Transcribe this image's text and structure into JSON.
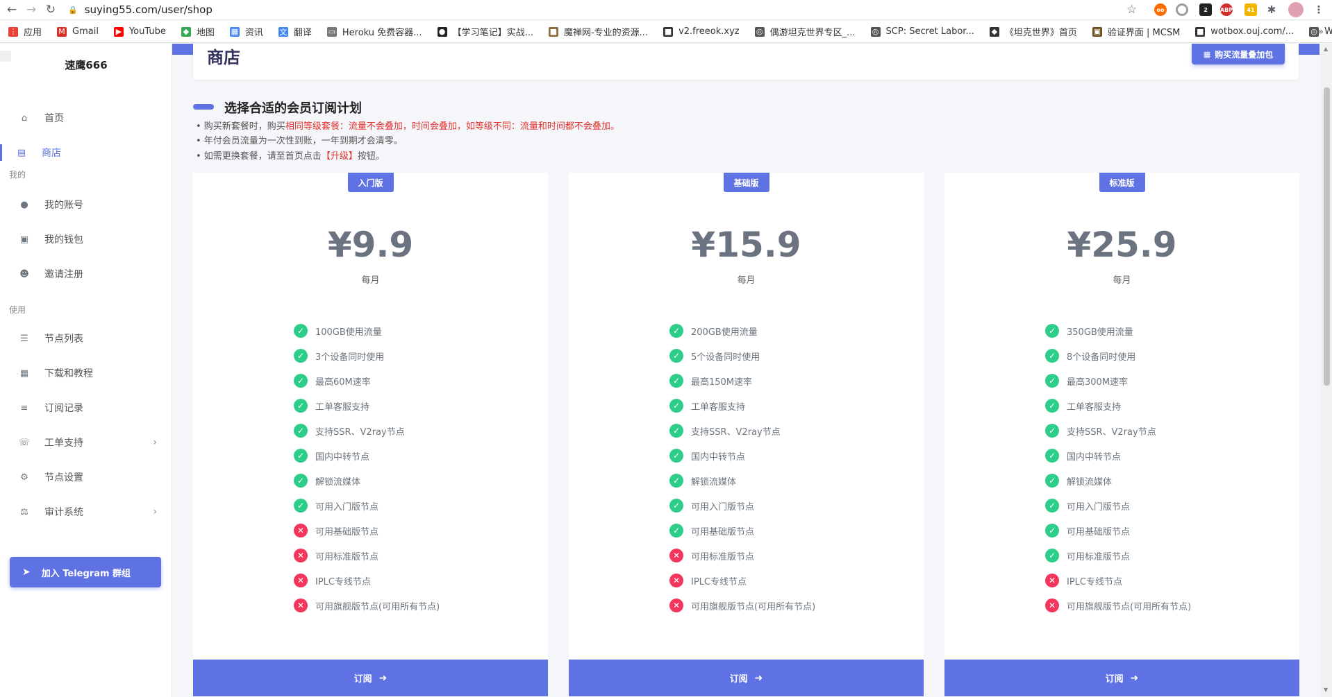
{
  "browser": {
    "url": "suying55.com/user/shop",
    "bookmarks": [
      {
        "label": "应用",
        "icon": "apps-icon",
        "color": "#e94235"
      },
      {
        "label": "Gmail",
        "icon": "gmail-icon",
        "color": "#d93025"
      },
      {
        "label": "YouTube",
        "icon": "youtube-icon",
        "color": "#ff0000"
      },
      {
        "label": "地图",
        "icon": "maps-icon",
        "color": "#34a853"
      },
      {
        "label": "资讯",
        "icon": "news-icon",
        "color": "#4285f4"
      },
      {
        "label": "翻译",
        "icon": "translate-icon",
        "color": "#4285f4"
      },
      {
        "label": "Heroku 免费容器...",
        "icon": "page-icon",
        "color": "#777777"
      },
      {
        "label": "【学习笔记】实战...",
        "icon": "github-icon",
        "color": "#222222"
      },
      {
        "label": "魔禅网-专业的资源...",
        "icon": "site-icon",
        "color": "#8a6d3b"
      },
      {
        "label": "v2.freeok.xyz",
        "icon": "site-icon",
        "color": "#333333"
      },
      {
        "label": "偶游坦克世界专区_...",
        "icon": "globe-icon",
        "color": "#555555"
      },
      {
        "label": "SCP: Secret Labor...",
        "icon": "globe-icon",
        "color": "#555555"
      },
      {
        "label": "《坦克世界》首页",
        "icon": "shield-icon",
        "color": "#333333"
      },
      {
        "label": "验证界面 | MCSM",
        "icon": "cube-icon",
        "color": "#6b4f1d"
      },
      {
        "label": "wotbox.ouj.com/...",
        "icon": "site-icon",
        "color": "#333333"
      },
      {
        "label": "WebsiteAsteroids",
        "icon": "globe-icon",
        "color": "#555555"
      }
    ]
  },
  "sidebar": {
    "brand": "速鹰666",
    "sections": {
      "mine": "我的",
      "use": "使用"
    },
    "items": [
      {
        "label": "首页",
        "icon": "home-icon"
      },
      {
        "label": "商店",
        "icon": "shop-icon"
      },
      {
        "label": "我的账号",
        "icon": "user-icon"
      },
      {
        "label": "我的钱包",
        "icon": "wallet-icon"
      },
      {
        "label": "邀请注册",
        "icon": "invite-icon"
      },
      {
        "label": "节点列表",
        "icon": "list-icon"
      },
      {
        "label": "下载和教程",
        "icon": "book-icon"
      },
      {
        "label": "订阅记录",
        "icon": "records-icon"
      },
      {
        "label": "工单支持",
        "icon": "support-icon"
      },
      {
        "label": "节点设置",
        "icon": "gear-icon"
      },
      {
        "label": "审计系统",
        "icon": "scale-icon"
      }
    ],
    "telegram": "加入 Telegram 群组"
  },
  "main": {
    "page_title": "商店",
    "buy_traffic": "购买流量叠加包",
    "section_title": "选择合适的会员订阅计划",
    "notes": {
      "n1_a": "• 购买新套餐时，购买",
      "n1_b": "相同等级套餐：流量不会叠加，时间会叠加，如等级不同：流量和时间都不会叠加。",
      "n2": "• 年付会员流量为一次性到账，一年到期才会清零。",
      "n3_a": "• 如需更换套餐，请至首页点击",
      "n3_b": "【升级】",
      "n3_c": "按钮。"
    }
  },
  "plans": [
    {
      "badge": "入门版",
      "price": "¥9.9",
      "period": "每月",
      "subscribe": "订阅",
      "features": [
        {
          "text": "100GB使用流量",
          "ok": true
        },
        {
          "text": "3个设备同时使用",
          "ok": true
        },
        {
          "text": "最高60M速率",
          "ok": true
        },
        {
          "text": "工单客服支持",
          "ok": true
        },
        {
          "text": "支持SSR、V2ray节点",
          "ok": true
        },
        {
          "text": "国内中转节点",
          "ok": true
        },
        {
          "text": "解锁流媒体",
          "ok": true
        },
        {
          "text": "可用入门版节点",
          "ok": true
        },
        {
          "text": "可用基础版节点",
          "ok": false
        },
        {
          "text": "可用标准版节点",
          "ok": false
        },
        {
          "text": "IPLC专线节点",
          "ok": false
        },
        {
          "text": "可用旗舰版节点(可用所有节点)",
          "ok": false
        }
      ]
    },
    {
      "badge": "基础版",
      "price": "¥15.9",
      "period": "每月",
      "subscribe": "订阅",
      "features": [
        {
          "text": "200GB使用流量",
          "ok": true
        },
        {
          "text": "5个设备同时使用",
          "ok": true
        },
        {
          "text": "最高150M速率",
          "ok": true
        },
        {
          "text": "工单客服支持",
          "ok": true
        },
        {
          "text": "支持SSR、V2ray节点",
          "ok": true
        },
        {
          "text": "国内中转节点",
          "ok": true
        },
        {
          "text": "解锁流媒体",
          "ok": true
        },
        {
          "text": "可用入门版节点",
          "ok": true
        },
        {
          "text": "可用基础版节点",
          "ok": true
        },
        {
          "text": "可用标准版节点",
          "ok": false
        },
        {
          "text": "IPLC专线节点",
          "ok": false
        },
        {
          "text": "可用旗舰版节点(可用所有节点)",
          "ok": false
        }
      ]
    },
    {
      "badge": "标准版",
      "price": "¥25.9",
      "period": "每月",
      "subscribe": "订阅",
      "features": [
        {
          "text": "350GB使用流量",
          "ok": true
        },
        {
          "text": "8个设备同时使用",
          "ok": true
        },
        {
          "text": "最高300M速率",
          "ok": true
        },
        {
          "text": "工单客服支持",
          "ok": true
        },
        {
          "text": "支持SSR、V2ray节点",
          "ok": true
        },
        {
          "text": "国内中转节点",
          "ok": true
        },
        {
          "text": "解锁流媒体",
          "ok": true
        },
        {
          "text": "可用入门版节点",
          "ok": true
        },
        {
          "text": "可用基础版节点",
          "ok": true
        },
        {
          "text": "可用标准版节点",
          "ok": true
        },
        {
          "text": "IPLC专线节点",
          "ok": false
        },
        {
          "text": "可用旗舰版节点(可用所有节点)",
          "ok": false
        }
      ]
    }
  ],
  "colors": {
    "accent": "#5e72e4",
    "check": "#2dce89",
    "cross": "#f5365c",
    "warning_text": "#e3342f"
  }
}
